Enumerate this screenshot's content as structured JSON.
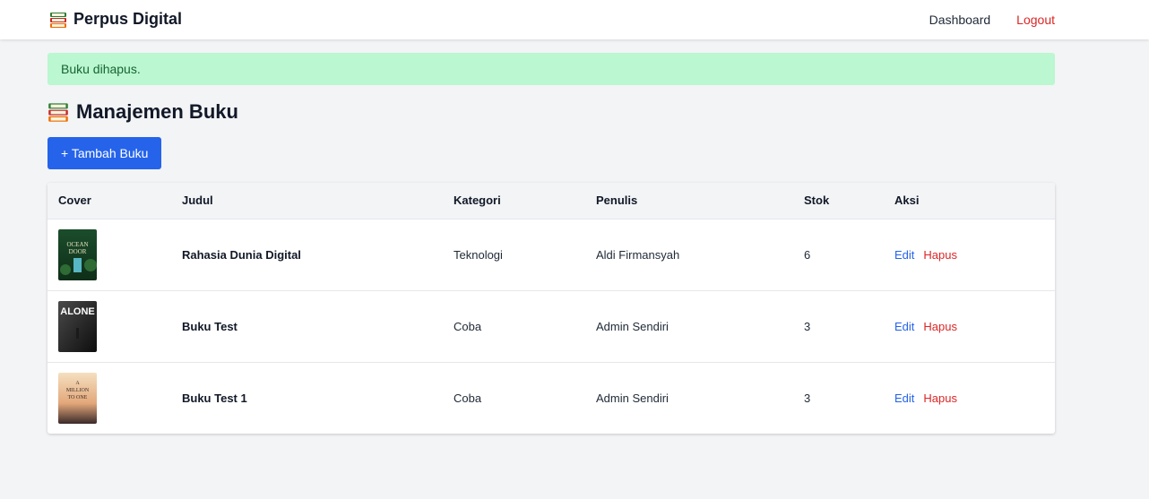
{
  "brand": {
    "name": "Perpus Digital",
    "icon": "books-icon"
  },
  "nav": {
    "dashboard": "Dashboard",
    "logout": "Logout"
  },
  "alert": {
    "message": "Buku dihapus."
  },
  "page": {
    "title": "Manajemen Buku",
    "add_button": "+ Tambah Buku"
  },
  "table": {
    "headers": [
      "Cover",
      "Judul",
      "Kategori",
      "Penulis",
      "Stok",
      "Aksi"
    ],
    "rows": [
      {
        "cover_text": "OCEAN DOOR",
        "title": "Rahasia Dunia Digital",
        "category": "Teknologi",
        "author": "Aldi Firmansyah",
        "stock": "6",
        "edit": "Edit",
        "delete": "Hapus"
      },
      {
        "cover_text": "ALONE",
        "title": "Buku Test",
        "category": "Coba",
        "author": "Admin Sendiri",
        "stock": "3",
        "edit": "Edit",
        "delete": "Hapus"
      },
      {
        "cover_text": "A MILLION TO ONE",
        "title": "Buku Test 1",
        "category": "Coba",
        "author": "Admin Sendiri",
        "stock": "3",
        "edit": "Edit",
        "delete": "Hapus"
      }
    ]
  },
  "colors": {
    "primary": "#2563eb",
    "danger": "#dc2626",
    "success_bg": "#bbf7d0",
    "success_text": "#166534"
  }
}
